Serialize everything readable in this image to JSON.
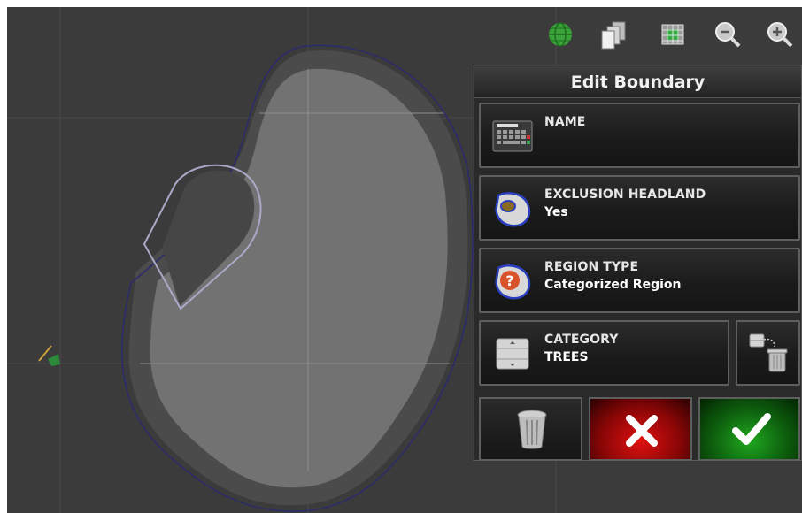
{
  "panel": {
    "title": "Edit Boundary",
    "rows": [
      {
        "label": "NAME",
        "value": ""
      },
      {
        "label": "EXCLUSION HEADLAND",
        "value": "Yes"
      },
      {
        "label": "REGION TYPE",
        "value": "Categorized Region"
      },
      {
        "label": "CATEGORY",
        "value": "TREES"
      }
    ]
  },
  "toolbar": {
    "icons": [
      "globe-icon",
      "layers-icon",
      "field-view-icon",
      "zoom-out-icon",
      "zoom-in-icon"
    ]
  },
  "actions": [
    "delete-icon",
    "cancel-icon",
    "confirm-icon"
  ],
  "colors": {
    "map_background": "#3b3b3b",
    "field": "#6c6c6c",
    "headland": "#4a4a4a",
    "boundary_line": "#2c2a6e",
    "exclusion_outline": "#a9a9c8",
    "cancel": "#d01010",
    "confirm": "#1c9a1c"
  }
}
